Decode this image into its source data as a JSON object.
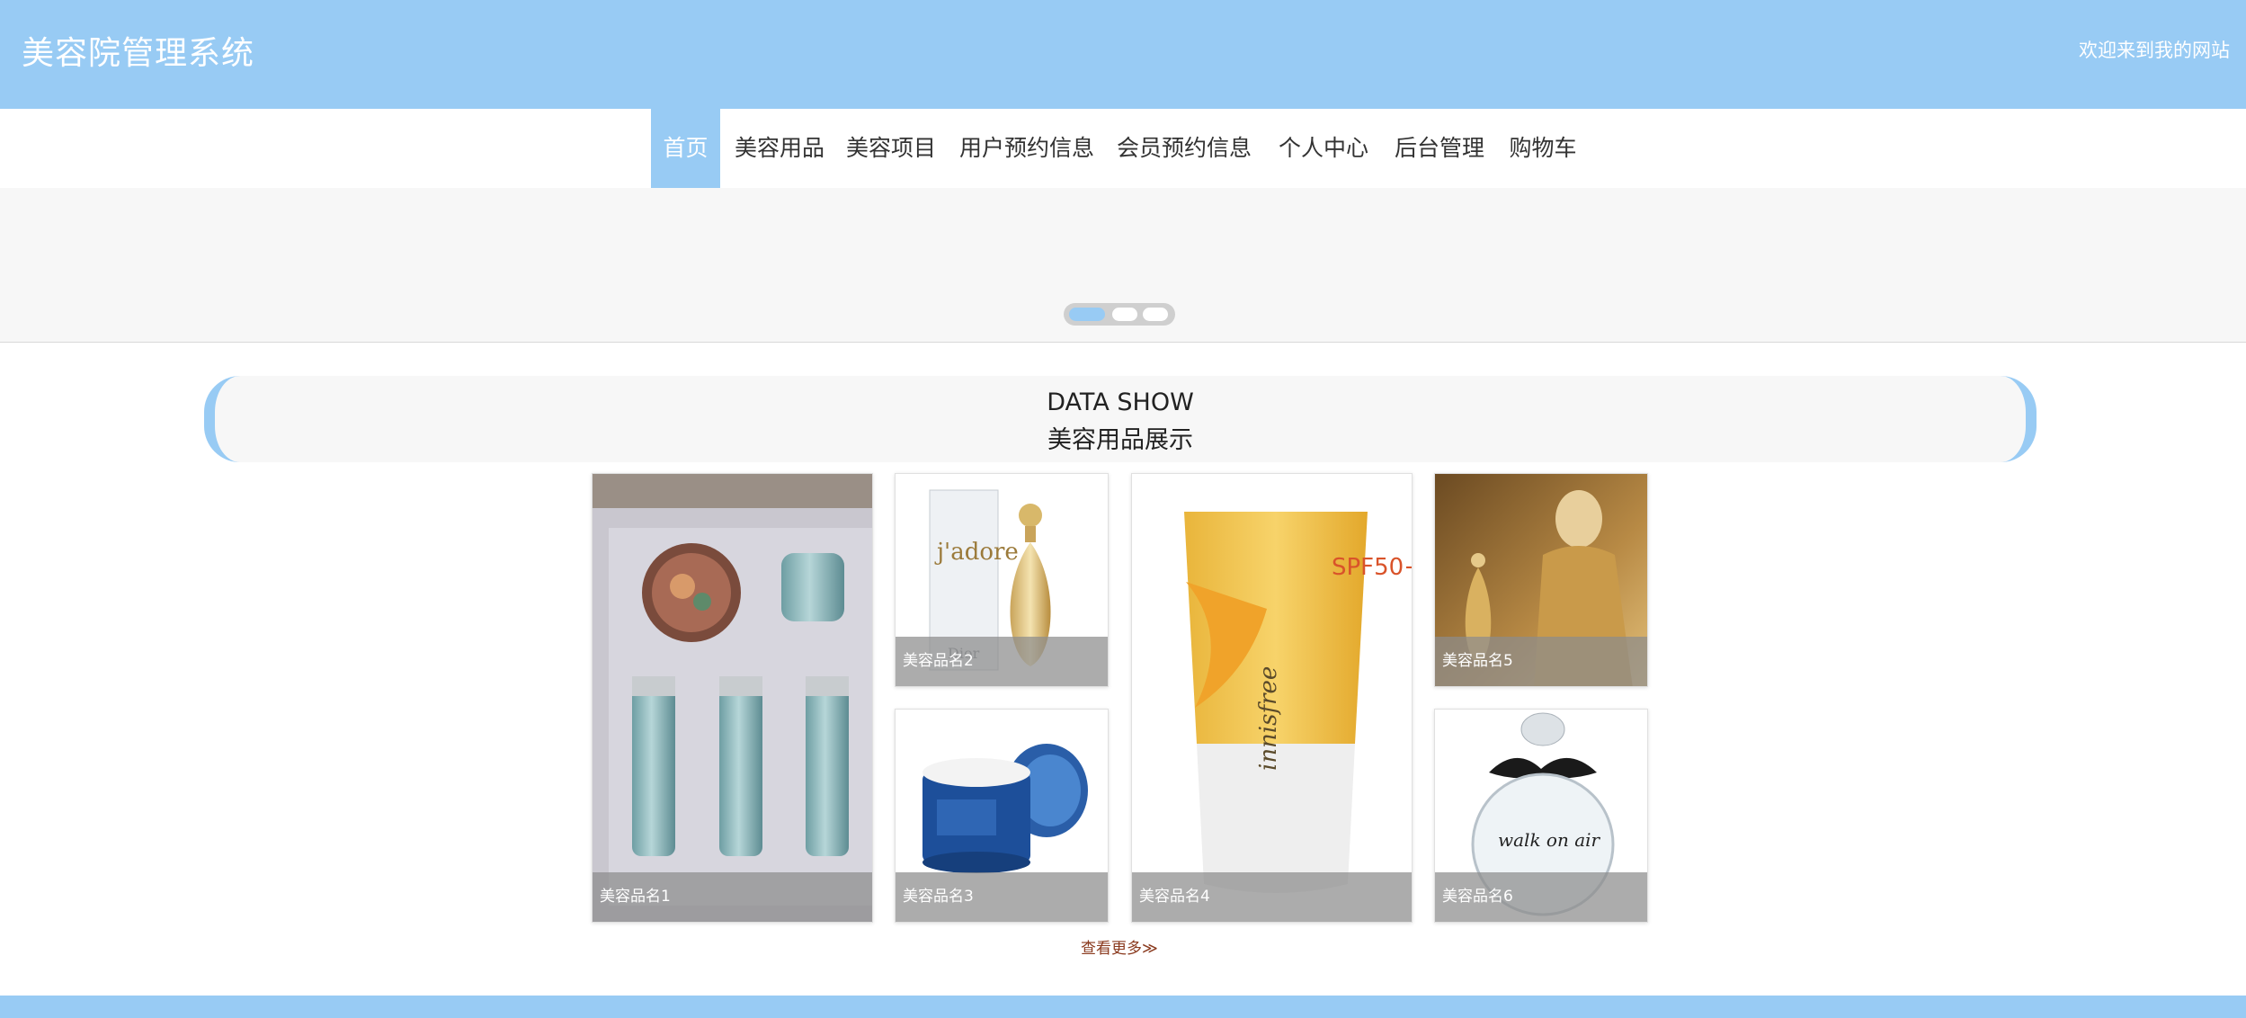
{
  "header": {
    "title": "美容院管理系统",
    "welcome": "欢迎来到我的网站"
  },
  "nav": {
    "items": [
      "首页",
      "美容用品",
      "美容项目",
      "用户预约信息",
      "会员预约信息",
      "个人中心",
      "后台管理",
      "购物车"
    ],
    "active_index": 0
  },
  "banner": {
    "slide_count": 3,
    "active_slide": 1
  },
  "section": {
    "title_en": "DATA SHOW",
    "title_zh": "美容用品展示"
  },
  "products": [
    {
      "name": "美容品名1",
      "image": "skincare-set-image"
    },
    {
      "name": "美容品名2",
      "image": "perfume-bottle-image"
    },
    {
      "name": "美容品名3",
      "image": "cream-jar-image"
    },
    {
      "name": "美容品名4",
      "image": "sunblock-tube-image"
    },
    {
      "name": "美容品名5",
      "image": "perfume-ad-image"
    },
    {
      "name": "美容品名6",
      "image": "round-perfume-image"
    }
  ],
  "more_link": "查看更多≫",
  "colors": {
    "accent": "#98cbf4",
    "banner_bg": "#f7f7f7",
    "more_link": "#8a3a1e"
  }
}
